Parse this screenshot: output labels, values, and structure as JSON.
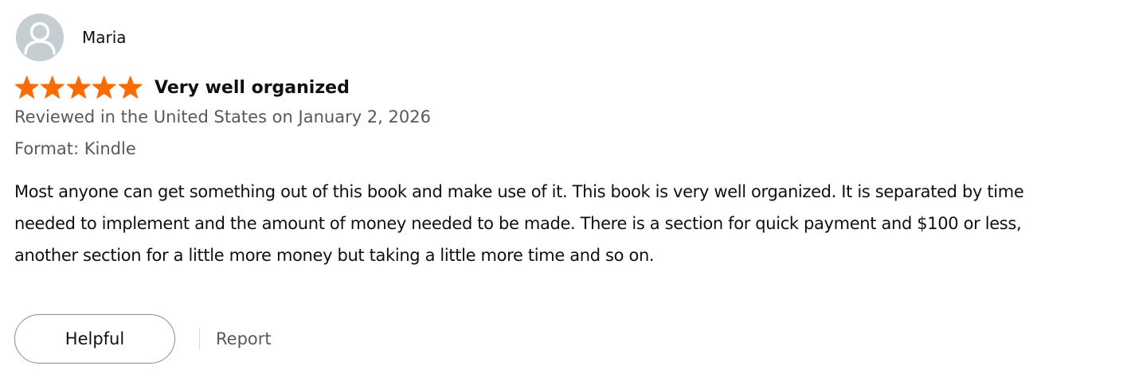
{
  "reviewer": {
    "name": "Maria",
    "avatar_icon": "user-silhouette-icon"
  },
  "review": {
    "rating": 5,
    "rating_max": 5,
    "star_color": "#ff6a00",
    "title": "Very well organized",
    "date_line": "Reviewed in the United States on January 2, 2026",
    "format_line": "Format: Kindle",
    "body": "Most anyone can get something out of this book and make use of it. This book is very well organized. It is separated by time needed to implement and the amount of money needed to be made. There is a section for quick payment and $100 or less, another section for a little more money but taking a little more time and so on."
  },
  "actions": {
    "helpful_label": "Helpful",
    "report_label": "Report"
  }
}
